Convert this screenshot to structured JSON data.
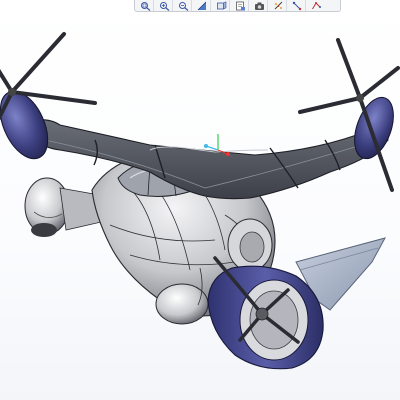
{
  "app": {
    "viewport_label": "3D model viewport"
  },
  "toolbar": {
    "buttons": [
      {
        "name": "zoom-to-fit-icon",
        "label": "Zoom to Fit"
      },
      {
        "name": "zoom-in-icon",
        "label": "Zoom In"
      },
      {
        "name": "zoom-out-icon",
        "label": "Zoom Out"
      },
      {
        "name": "section-view-icon",
        "label": "Section View"
      },
      {
        "name": "view-orientation-icon",
        "label": "View Orientation"
      },
      {
        "name": "display-style-icon",
        "label": "Display Style"
      },
      {
        "name": "camera-icon",
        "label": "Camera"
      },
      {
        "name": "explode-icon",
        "label": "Explode"
      },
      {
        "name": "measure-icon",
        "label": "Measure"
      },
      {
        "name": "markup-icon",
        "label": "Markup"
      }
    ]
  },
  "colors": {
    "body_gray": "#c9c9cc",
    "wing_dark": "#4a4d55",
    "prop_blue": "#3b3e7e",
    "tail_blue": "#a9b4c8",
    "edge": "#2a2a30"
  }
}
